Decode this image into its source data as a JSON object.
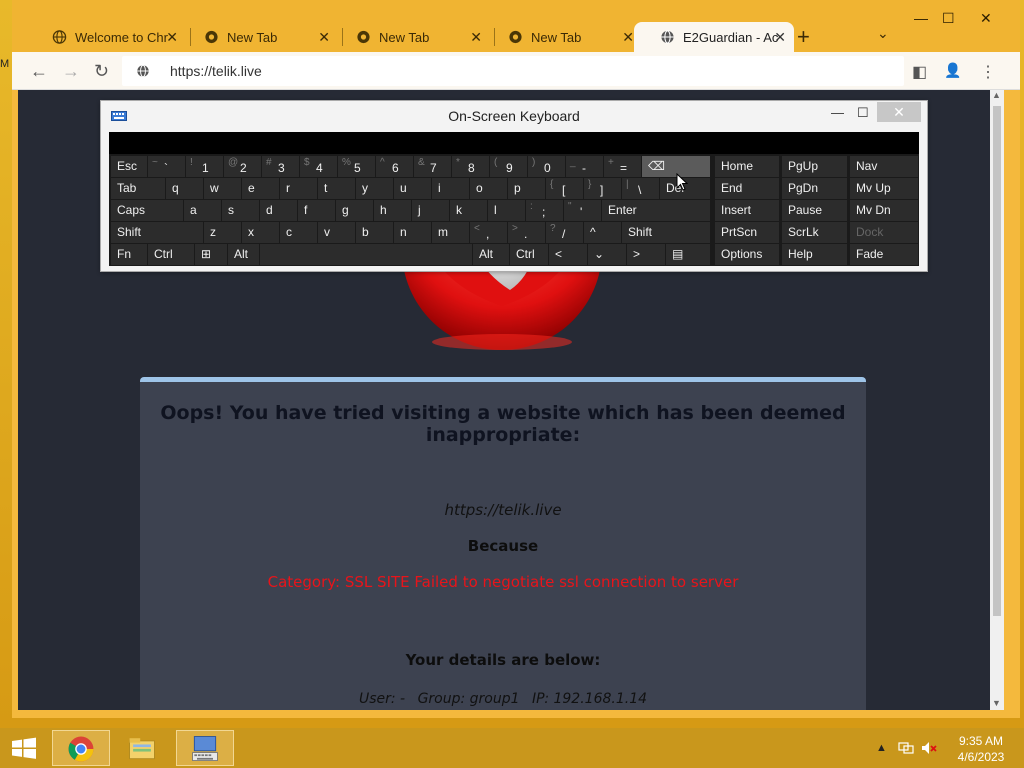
{
  "desktop": {
    "left_label": "M"
  },
  "browser": {
    "tabs": [
      {
        "title": "Welcome to Chr",
        "active": false
      },
      {
        "title": "New Tab",
        "active": false
      },
      {
        "title": "New Tab",
        "active": false
      },
      {
        "title": "New Tab",
        "active": false
      },
      {
        "title": "E2Guardian - Ac",
        "active": true
      }
    ],
    "new_tab_glyph": "+",
    "tab_menu_glyph": "⌄",
    "close_glyph": "✕",
    "window": {
      "minimize": "—",
      "maximize": "☐",
      "close": "✕"
    },
    "nav": {
      "back": "←",
      "forward": "→",
      "reload": "↻"
    },
    "address": "https://telik.live",
    "toolbar_right": {
      "sidepanel": "◧",
      "profile": "👤",
      "menu": "⋮"
    }
  },
  "page": {
    "headline": "Oops! You have tried visiting a website which has been deemed inappropriate:",
    "blocked_url": "https://telik.live",
    "because_label": "Because",
    "reason": "Category: SSL SITE   Failed to negotiate ssl connection to server",
    "details_title": "Your details are below:",
    "user": "User: -",
    "group": "Group: group1",
    "ip": "IP: 192.168.1.14"
  },
  "osk": {
    "title": "On-Screen Keyboard",
    "minimize": "—",
    "maximize": "☐",
    "close": "✕",
    "row1": [
      {
        "label": "Esc"
      },
      {
        "sup": "~",
        "main": "`"
      },
      {
        "sup": "!",
        "main": "1"
      },
      {
        "sup": "@",
        "main": "2"
      },
      {
        "sup": "#",
        "main": "3"
      },
      {
        "sup": "$",
        "main": "4"
      },
      {
        "sup": "%",
        "main": "5"
      },
      {
        "sup": "^",
        "main": "6"
      },
      {
        "sup": "&",
        "main": "7"
      },
      {
        "sup": "*",
        "main": "8"
      },
      {
        "sup": "(",
        "main": "9"
      },
      {
        "sup": ")",
        "main": "0"
      },
      {
        "sup": "_",
        "main": "-"
      },
      {
        "sup": "+",
        "main": "="
      },
      {
        "label": "⌫"
      }
    ],
    "row2": [
      {
        "label": "Tab"
      },
      {
        "label": "q"
      },
      {
        "label": "w"
      },
      {
        "label": "e"
      },
      {
        "label": "r"
      },
      {
        "label": "t"
      },
      {
        "label": "y"
      },
      {
        "label": "u"
      },
      {
        "label": "i"
      },
      {
        "label": "o"
      },
      {
        "label": "p"
      },
      {
        "sup": "{",
        "main": "["
      },
      {
        "sup": "}",
        "main": "]"
      },
      {
        "sup": "|",
        "main": "\\"
      },
      {
        "label": "Del"
      }
    ],
    "row3": [
      {
        "label": "Caps"
      },
      {
        "label": "a"
      },
      {
        "label": "s"
      },
      {
        "label": "d"
      },
      {
        "label": "f"
      },
      {
        "label": "g"
      },
      {
        "label": "h"
      },
      {
        "label": "j"
      },
      {
        "label": "k"
      },
      {
        "label": "l"
      },
      {
        "sup": ":",
        "main": ";"
      },
      {
        "sup": "\"",
        "main": "'"
      },
      {
        "label": "Enter"
      }
    ],
    "row4": [
      {
        "label": "Shift"
      },
      {
        "label": "z"
      },
      {
        "label": "x"
      },
      {
        "label": "c"
      },
      {
        "label": "v"
      },
      {
        "label": "b"
      },
      {
        "label": "n"
      },
      {
        "label": "m"
      },
      {
        "sup": "<",
        "main": ","
      },
      {
        "sup": ">",
        "main": "."
      },
      {
        "sup": "?",
        "main": "/"
      },
      {
        "label": "^"
      },
      {
        "label": "Shift"
      }
    ],
    "row5": [
      {
        "label": "Fn"
      },
      {
        "label": "Ctrl"
      },
      {
        "label": "⊞"
      },
      {
        "label": "Alt"
      },
      {
        "label": ""
      },
      {
        "label": "Alt"
      },
      {
        "label": "Ctrl"
      },
      {
        "label": "<"
      },
      {
        "label": "⌄"
      },
      {
        "label": ">"
      },
      {
        "label": "▤"
      }
    ],
    "nav_keys": [
      [
        "Home",
        "PgUp",
        "Nav"
      ],
      [
        "End",
        "PgDn",
        "Mv Up"
      ],
      [
        "Insert",
        "Pause",
        "Mv Dn"
      ],
      [
        "PrtScn",
        "ScrLk",
        "Dock"
      ],
      [
        "Options",
        "Help",
        "Fade"
      ]
    ]
  },
  "taskbar": {
    "clock_time": "9:35 AM",
    "clock_date": "4/6/2023",
    "tray_arrow": "▲"
  }
}
